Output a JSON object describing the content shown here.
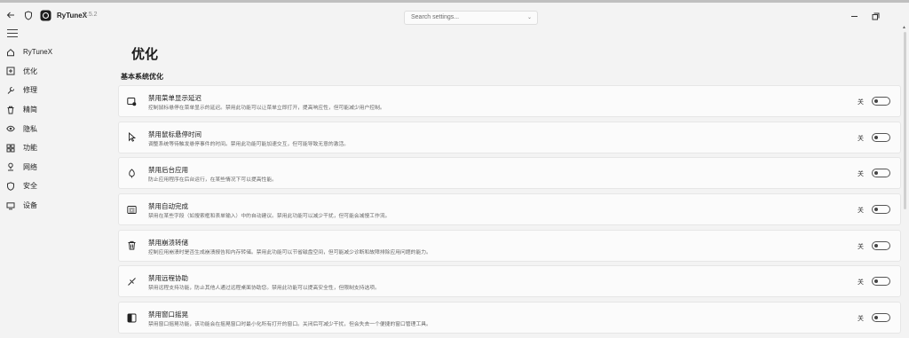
{
  "app": {
    "name": "RyTuneX",
    "version": "1.5.2"
  },
  "search": {
    "placeholder": "Search settings..."
  },
  "sidebar": {
    "items": [
      {
        "label": "RyTuneX",
        "icon": "home-icon"
      },
      {
        "label": "优化",
        "icon": "optimize-icon"
      },
      {
        "label": "修理",
        "icon": "wrench-icon"
      },
      {
        "label": "精简",
        "icon": "trash-icon"
      },
      {
        "label": "隐私",
        "icon": "eye-icon"
      },
      {
        "label": "功能",
        "icon": "grid-icon"
      },
      {
        "label": "网络",
        "icon": "network-icon"
      },
      {
        "label": "安全",
        "icon": "shield-icon"
      },
      {
        "label": "设备",
        "icon": "monitor-icon"
      }
    ]
  },
  "main": {
    "title": "优化",
    "section": "基本系统优化",
    "cards": [
      {
        "title": "禁用菜单显示延迟",
        "desc": "控制鼠标悬停在菜单显示的延迟。禁用此功能可以让菜单立即打开，提高响应性，但可能减少用户控制。",
        "state": "关",
        "icon": "menu-delay-icon"
      },
      {
        "title": "禁用鼠标悬停时间",
        "desc": "调整系统等待触发悬停事件的时间。禁用此功能可能加速交互，但可能导致无意的激活。",
        "state": "关",
        "icon": "cursor-icon"
      },
      {
        "title": "禁用后台应用",
        "desc": "防止应用程序在后台运行，在某些情况下可以提高性能。",
        "state": "关",
        "icon": "leaf-icon"
      },
      {
        "title": "禁用自动完成",
        "desc": "禁用在某些字段（如搜索框和表单输入）中的自动建议。禁用此功能可以减少干扰，但可能会减慢工作流。",
        "state": "关",
        "icon": "autocomplete-icon"
      },
      {
        "title": "禁用崩溃转储",
        "desc": "控制应用崩溃时是否生成崩溃报告和内存转储。禁用此功能可以节省磁盘空间，但可能减少诊断和故障排除应用问题的能力。",
        "state": "关",
        "icon": "trash-icon"
      },
      {
        "title": "禁用远程协助",
        "desc": "禁用远程支持功能，防止其他人通过远程桌面协助您。禁用此功能可以提高安全性，但限制支持选项。",
        "state": "关",
        "icon": "remote-icon"
      },
      {
        "title": "禁用窗口摇晃",
        "desc": "禁用窗口摇晃功能，该功能会在摇晃窗口时最小化所有打开的窗口。关闭后可减少干扰，但会失去一个便捷的窗口管理工具。",
        "state": "关",
        "icon": "window-shake-icon"
      }
    ]
  }
}
